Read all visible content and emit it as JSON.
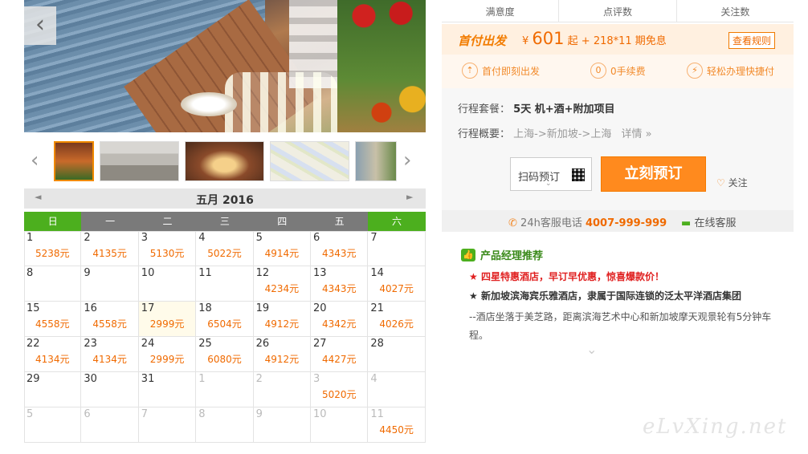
{
  "hero": {
    "prev_icon": "‹"
  },
  "thumbs": {
    "prev_icon": "‹",
    "next_icon": "›"
  },
  "calendar": {
    "title": "五月 2016",
    "prev_icon": "◄",
    "next_icon": "►",
    "weekdays": [
      "日",
      "一",
      "二",
      "三",
      "四",
      "五",
      "六"
    ],
    "weeks": [
      [
        {
          "d": "1",
          "p": "5238元"
        },
        {
          "d": "2",
          "p": "4135元"
        },
        {
          "d": "3",
          "p": "5130元"
        },
        {
          "d": "4",
          "p": "5022元"
        },
        {
          "d": "5",
          "p": "4914元"
        },
        {
          "d": "6",
          "p": "4343元"
        },
        {
          "d": "7",
          "p": ""
        }
      ],
      [
        {
          "d": "8",
          "p": ""
        },
        {
          "d": "9",
          "p": ""
        },
        {
          "d": "10",
          "p": ""
        },
        {
          "d": "11",
          "p": ""
        },
        {
          "d": "12",
          "p": "4234元"
        },
        {
          "d": "13",
          "p": "4343元"
        },
        {
          "d": "14",
          "p": "4027元"
        }
      ],
      [
        {
          "d": "15",
          "p": "4558元"
        },
        {
          "d": "16",
          "p": "4558元"
        },
        {
          "d": "17",
          "p": "2999元",
          "today": true
        },
        {
          "d": "18",
          "p": "6504元"
        },
        {
          "d": "19",
          "p": "4912元"
        },
        {
          "d": "20",
          "p": "4342元"
        },
        {
          "d": "21",
          "p": "4026元"
        }
      ],
      [
        {
          "d": "22",
          "p": "4134元"
        },
        {
          "d": "23",
          "p": "4134元"
        },
        {
          "d": "24",
          "p": "2999元"
        },
        {
          "d": "25",
          "p": "6080元"
        },
        {
          "d": "26",
          "p": "4912元"
        },
        {
          "d": "27",
          "p": "4427元"
        },
        {
          "d": "28",
          "p": ""
        }
      ],
      [
        {
          "d": "29",
          "p": ""
        },
        {
          "d": "30",
          "p": ""
        },
        {
          "d": "31",
          "p": ""
        },
        {
          "d": "1",
          "p": "",
          "other": true
        },
        {
          "d": "2",
          "p": "",
          "other": true
        },
        {
          "d": "3",
          "p": "5020元",
          "other": true
        },
        {
          "d": "4",
          "p": "",
          "other": true
        }
      ],
      [
        {
          "d": "5",
          "p": "",
          "other": true
        },
        {
          "d": "6",
          "p": "",
          "other": true
        },
        {
          "d": "7",
          "p": "",
          "other": true
        },
        {
          "d": "8",
          "p": "",
          "other": true
        },
        {
          "d": "9",
          "p": "",
          "other": true
        },
        {
          "d": "10",
          "p": "",
          "other": true
        },
        {
          "d": "11",
          "p": "4450元",
          "other": true
        }
      ]
    ]
  },
  "stats": {
    "satisfaction": "满意度",
    "reviews": "点评数",
    "follows": "关注数"
  },
  "pay": {
    "logo": "首付出发",
    "currency": "¥",
    "amount": "601",
    "suffix": "起 + 218*11 期免息",
    "rule_button": "查看规则"
  },
  "features": [
    {
      "icon": "⇡",
      "label": "首付即刻出发"
    },
    {
      "icon": "0",
      "label": "0手续费"
    },
    {
      "icon": "⚡",
      "label": "轻松办理快捷付"
    }
  ],
  "detail": {
    "package_label": "行程套餐：",
    "package_value": "5天  机+酒+附加项目",
    "overview_label": "行程概要：",
    "overview_value": "上海->新加坡->上海",
    "more_link": "详情 »"
  },
  "actions": {
    "scan_label": "扫码预订",
    "scan_chevron": "⌄",
    "book_label": "立刻预订",
    "follow_icon": "♡",
    "follow_label": "关注"
  },
  "hotline": {
    "phone_icon": "✆",
    "phone_label": "24h客服电话 ",
    "phone_number": "4007-999-999",
    "chat_icon": "▬",
    "chat_label": "在线客服"
  },
  "recommend": {
    "icon": "👍",
    "title": "产品经理推荐",
    "star": "★",
    "line1": " 四星特惠酒店，早订早优惠，惊喜爆款价！",
    "line2": " 新加坡滨海宾乐雅酒店，隶属于国际连锁的泛太平洋酒店集团",
    "line3": "--酒店坐落于美芝路，距离滨海艺术中心和新加坡摩天观景轮有5分钟车程。",
    "expand_icon": "⌄"
  },
  "watermark": "eLvXing.net",
  "colors": {
    "accent": "#f06a00",
    "green": "#4caf1e",
    "red": "#e02020"
  }
}
